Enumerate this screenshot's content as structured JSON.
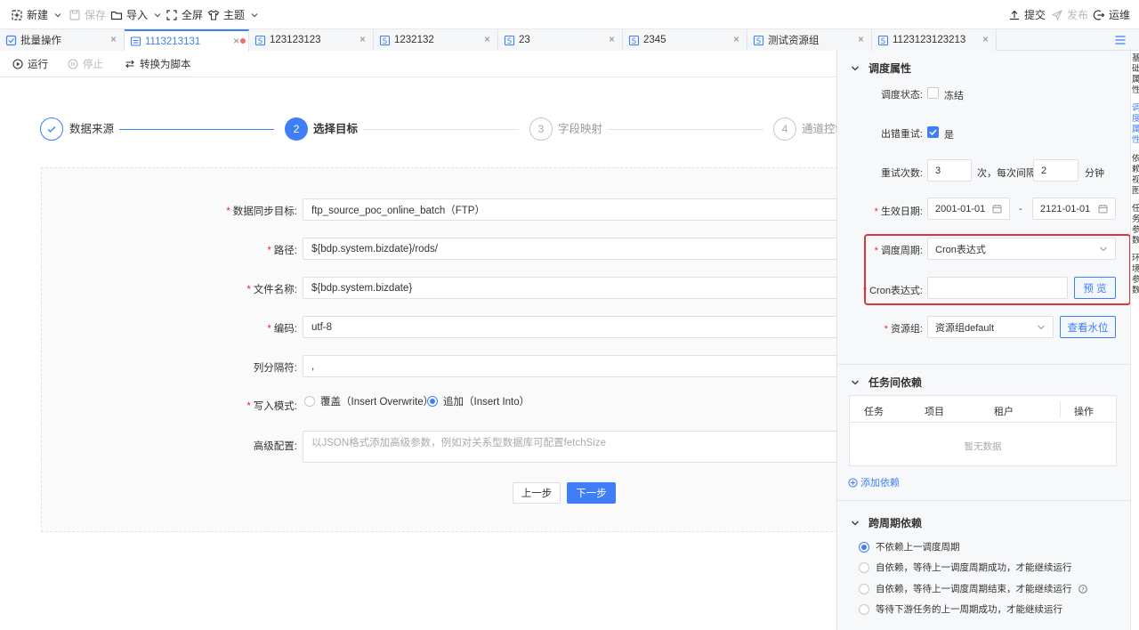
{
  "toolbar": {
    "new_label": "新建",
    "save_label": "保存",
    "import_label": "导入",
    "fullscreen_label": "全屏",
    "theme_label": "主题",
    "submit_label": "提交",
    "publish_label": "发布",
    "ops_label": "运维"
  },
  "tabs": [
    {
      "label": "批量操作"
    },
    {
      "label": "1113213131"
    },
    {
      "label": "123123123"
    },
    {
      "label": "1232132"
    },
    {
      "label": "23"
    },
    {
      "label": "2345"
    },
    {
      "label": "测试资源组"
    },
    {
      "label": "1123123123213"
    }
  ],
  "subtoolbar": {
    "run_label": "运行",
    "stop_label": "停止",
    "convert_label": "转换为脚本"
  },
  "steps": [
    {
      "label": "数据来源"
    },
    {
      "number": "2",
      "label": "选择目标"
    },
    {
      "number": "3",
      "label": "字段映射"
    },
    {
      "number": "4",
      "label": "通道控制"
    }
  ],
  "form": {
    "target_label": "数据同步目标:",
    "target_value": "ftp_source_poc_online_batch（FTP）",
    "path_label": "路径:",
    "path_value": "${bdp.system.bizdate}/rods/",
    "filename_label": "文件名称:",
    "filename_value": "${bdp.system.bizdate}",
    "encoding_label": "编码:",
    "encoding_value": "utf-8",
    "delimiter_label": "列分隔符:",
    "delimiter_value": ",",
    "write_mode_label": "写入模式:",
    "write_mode_overwrite": "覆盖（Insert Overwrite）",
    "write_mode_append": "追加（Insert Into）",
    "advanced_label": "高级配置:",
    "advanced_placeholder": "以JSON格式添加高级参数，例如对关系型数据库可配置fetchSize",
    "prev_label": "上一步",
    "next_label": "下一步"
  },
  "schedule": {
    "title": "调度属性",
    "status_label": "调度状态:",
    "freeze_label": "冻结",
    "retry_label": "出错重试:",
    "retry_yes": "是",
    "retry_count_label": "重试次数:",
    "retry_count_value": "3",
    "retry_interval_text": "次，每次间隔",
    "retry_interval_value": "2",
    "minute_text": "分钟",
    "effective_label": "生效日期:",
    "start_date": "2001-01-01",
    "date_sep": "-",
    "end_date": "2121-01-01",
    "period_label": "调度周期:",
    "period_value": "Cron表达式",
    "cron_label": "Cron表达式:",
    "cron_value": "",
    "preview_label": "预 览",
    "resource_label": "资源组:",
    "resource_value": "资源组default",
    "water_label": "查看水位"
  },
  "dependency": {
    "title": "任务间依赖",
    "columns": [
      "任务",
      "项目",
      "租户",
      "操作"
    ],
    "empty_text": "暂无数据",
    "add_label": "添加依赖"
  },
  "cross": {
    "title": "跨周期依赖",
    "options": [
      "不依赖上一调度周期",
      "自依赖，等待上一调度周期成功，才能继续运行",
      "自依赖，等待上一调度周期结束，才能继续运行",
      "等待下游任务的上一周期成功，才能继续运行"
    ]
  },
  "sidetabs": [
    "基础属性",
    "调度属性",
    "依赖视图",
    "任务参数",
    "环境参数"
  ],
  "colors": {
    "accent": "#3f7ef6",
    "required": "#f5222d",
    "highlight": "#d9363e",
    "modified_dot": "#f56c6c"
  }
}
